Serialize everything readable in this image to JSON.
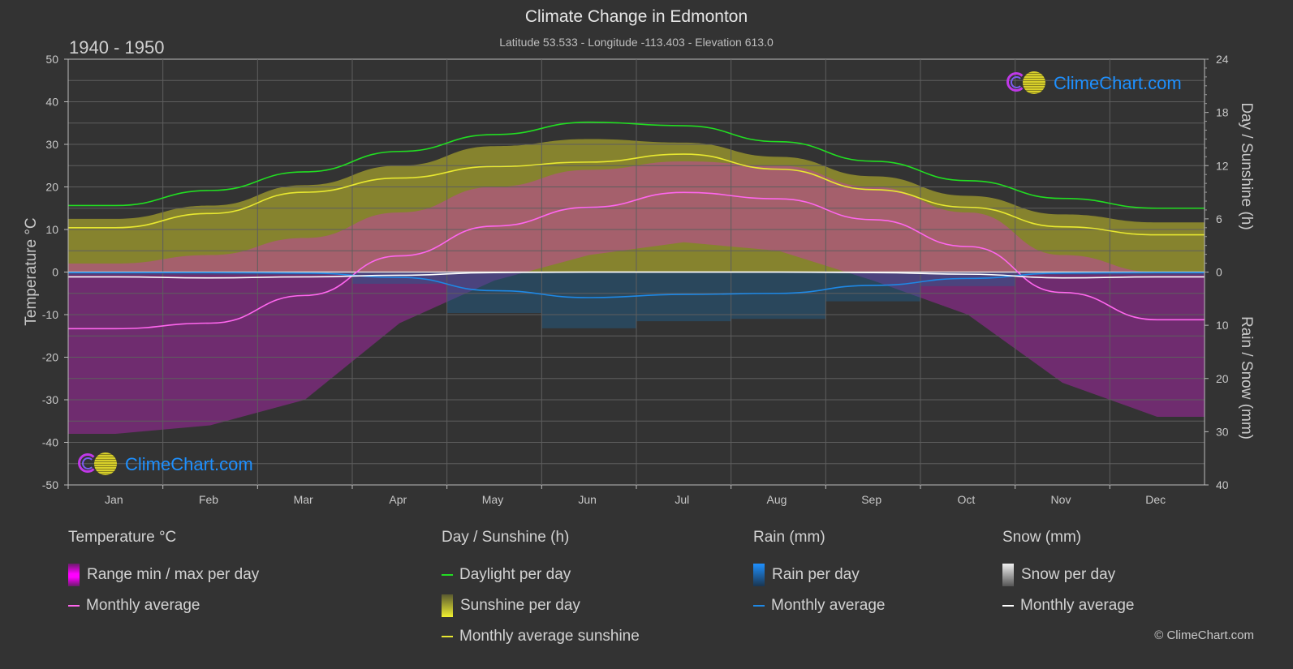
{
  "header": {
    "title": "Climate Change in Edmonton",
    "subtitle": "Latitude 53.533 - Longitude -113.403 - Elevation 613.0",
    "period": "1940 - 1950"
  },
  "logo": {
    "text": "ClimeChart.com"
  },
  "copyright": "© ClimeChart.com",
  "colors": {
    "background": "#333333",
    "temp_avg": "#ff66ee",
    "temp_range": "#e020e0",
    "daylight": "#22dd22",
    "sunshine_avg": "#e8e830",
    "sunshine_fill": "#8f8c2e",
    "rain_avg": "#1e88e5",
    "rain_fill": "#1f5f8f",
    "snow_avg": "#ffffff",
    "grid": "#5a5a5a"
  },
  "chart_data": {
    "type": "line",
    "title": "Climate Change in Edmonton",
    "categories": [
      "Jan",
      "Feb",
      "Mar",
      "Apr",
      "May",
      "Jun",
      "Jul",
      "Aug",
      "Sep",
      "Oct",
      "Nov",
      "Dec"
    ],
    "axes": {
      "left": {
        "label": "Temperature °C",
        "ylim": [
          -50,
          50
        ],
        "ticks": [
          50,
          40,
          30,
          20,
          10,
          0,
          -10,
          -20,
          -30,
          -40,
          -50
        ]
      },
      "right_top": {
        "label": "Day / Sunshine (h)",
        "ylim": [
          0,
          24
        ],
        "ticks": [
          24,
          18,
          12,
          6,
          0
        ]
      },
      "right_bottom": {
        "label": "Rain / Snow (mm)",
        "ylim": [
          0,
          40
        ],
        "ticks": [
          0,
          10,
          20,
          30,
          40
        ]
      }
    },
    "grid": true,
    "series": [
      {
        "name": "Temperature monthly average",
        "unit": "°C",
        "axis": "left",
        "values": [
          -13.3,
          -12.0,
          -5.5,
          3.8,
          10.8,
          15.2,
          18.7,
          17.2,
          12.3,
          6.0,
          -4.8,
          -11.2
        ]
      },
      {
        "name": "Daylight per day",
        "unit": "h",
        "axis": "right_top",
        "values": [
          7.5,
          9.2,
          11.3,
          13.6,
          15.5,
          16.9,
          16.5,
          14.7,
          12.5,
          10.3,
          8.3,
          7.2
        ]
      },
      {
        "name": "Monthly average sunshine",
        "unit": "h",
        "axis": "right_top",
        "values": [
          5.0,
          6.6,
          9.0,
          10.6,
          11.9,
          12.4,
          13.3,
          11.6,
          9.3,
          7.3,
          5.1,
          4.2
        ]
      },
      {
        "name": "Rain monthly average",
        "unit": "mm",
        "axis": "right_bottom",
        "values": [
          0.1,
          0.1,
          0.2,
          1.0,
          3.5,
          4.8,
          4.2,
          4.0,
          2.5,
          1.2,
          0.2,
          0.1
        ]
      },
      {
        "name": "Snow monthly average",
        "unit": "mm",
        "axis": "right_bottom",
        "values": [
          0.9,
          1.1,
          0.9,
          0.6,
          0.1,
          0.0,
          0.0,
          0.0,
          0.1,
          0.4,
          1.1,
          0.9
        ]
      }
    ],
    "daily_sunshine_envelope_h": [
      6.0,
      7.5,
      9.8,
      12.0,
      14.2,
      15.0,
      14.6,
      13.0,
      10.8,
      8.6,
      6.5,
      5.6
    ],
    "temp_range_envelope": {
      "max": [
        2,
        4,
        8,
        14,
        20,
        24,
        26,
        25,
        20,
        14,
        4,
        0
      ],
      "min": [
        -38,
        -36,
        -30,
        -12,
        -2,
        4,
        7,
        5,
        -2,
        -10,
        -26,
        -34
      ]
    }
  },
  "legend": {
    "groups": [
      {
        "title": "Temperature °C",
        "items": [
          {
            "label": "Range min / max per day",
            "kind": "bar"
          },
          {
            "label": "Monthly average",
            "kind": "line"
          }
        ]
      },
      {
        "title": "Day / Sunshine (h)",
        "items": [
          {
            "label": "Daylight per day",
            "kind": "line"
          },
          {
            "label": "Sunshine per day",
            "kind": "bar"
          },
          {
            "label": "Monthly average sunshine",
            "kind": "line"
          }
        ]
      },
      {
        "title": "Rain (mm)",
        "items": [
          {
            "label": "Rain per day",
            "kind": "bar"
          },
          {
            "label": "Monthly average",
            "kind": "line"
          }
        ]
      },
      {
        "title": "Snow (mm)",
        "items": [
          {
            "label": "Snow per day",
            "kind": "bar"
          },
          {
            "label": "Monthly average",
            "kind": "line"
          }
        ]
      }
    ]
  }
}
